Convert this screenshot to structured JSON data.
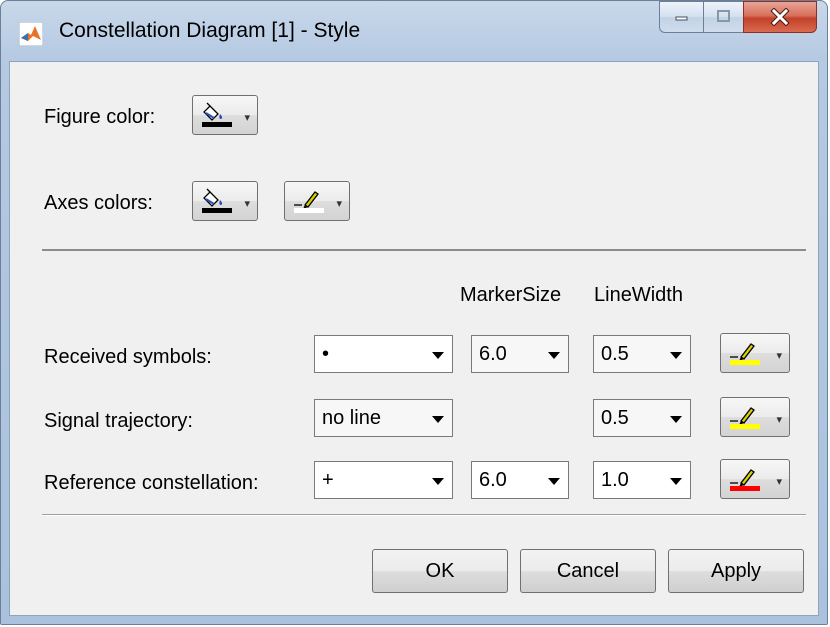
{
  "window": {
    "title": "Constellation Diagram [1] - Style",
    "controls": {
      "minimize": "minimize",
      "maximize": "maximize",
      "close": "close"
    }
  },
  "figure": {
    "label": "Figure color:",
    "fill_color": "#000000"
  },
  "axes": {
    "label": "Axes colors:",
    "fill_color": "#000000",
    "line_color": "#ffffff"
  },
  "columns": {
    "marker_size": "MarkerSize",
    "line_width": "LineWidth"
  },
  "rows": [
    {
      "label": "Received symbols:",
      "marker": "•",
      "marker_size": "6.0",
      "line_width": "0.5",
      "color": "#ffff00"
    },
    {
      "label": "Signal trajectory:",
      "marker": "no line",
      "marker_size": null,
      "line_width": "0.5",
      "color": "#ffff00"
    },
    {
      "label": "Reference constellation:",
      "marker": "+",
      "marker_size": "6.0",
      "line_width": "1.0",
      "color": "#ff0000"
    }
  ],
  "buttons": {
    "ok": "OK",
    "cancel": "Cancel",
    "apply": "Apply"
  }
}
